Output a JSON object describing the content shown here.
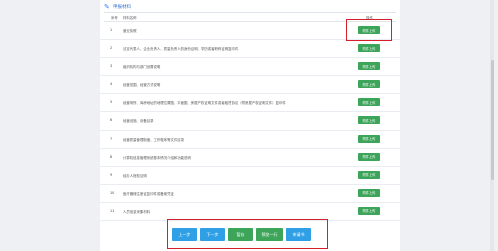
{
  "header": {
    "title": "申报材料"
  },
  "table": {
    "col_seq": "序号",
    "col_name": "材料名称",
    "col_op": "操作",
    "upload_label": "附件上传",
    "rows": [
      {
        "seq": "1",
        "name": "营业执照"
      },
      {
        "seq": "2",
        "name": "法定代表人、企业负责人、质量负责人的身份证明、学历或者职称证明复印件"
      },
      {
        "seq": "3",
        "name": "组织机构与部门设置说明"
      },
      {
        "seq": "4",
        "name": "经营范围、经营方式说明"
      },
      {
        "seq": "5",
        "name": "经营场所、库房地址的地理位置图、平面图、房屋产权证明文件或者租赁协议（附房屋产权证明文件）复印件"
      },
      {
        "seq": "6",
        "name": "经营设施、设备目录"
      },
      {
        "seq": "7",
        "name": "经营质量管理制度、工作程序等文件目录"
      },
      {
        "seq": "8",
        "name": "计算机信息管理系统基本情况介绍和功能说明"
      },
      {
        "seq": "9",
        "name": "经办人授权证明"
      },
      {
        "seq": "10",
        "name": "医疗器械注册证复印件或备案凭证"
      },
      {
        "seq": "11",
        "name": "人员信息采集材料"
      }
    ]
  },
  "actions": {
    "prev": "上一步",
    "next": "下一步",
    "save": "暂存",
    "preview": "预览一行",
    "submit": "申请书"
  },
  "colors": {
    "primary_blue": "#2fa0e6",
    "primary_green": "#3da55a",
    "highlight_red": "#d81e2a"
  }
}
